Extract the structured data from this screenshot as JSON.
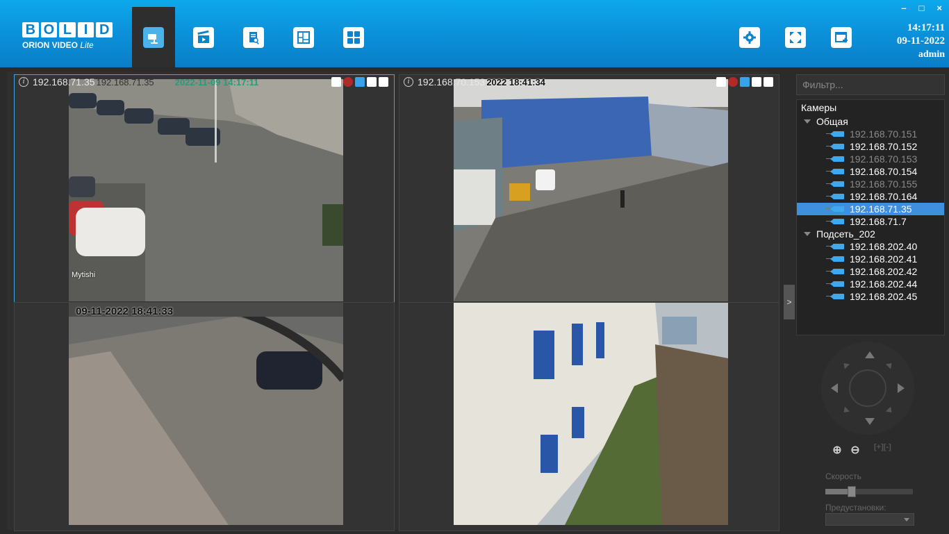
{
  "app": {
    "logo_letters": [
      "B",
      "O",
      "L",
      "I",
      "D"
    ],
    "logo_sub": "ORION VIDEO",
    "logo_sub_italic": "Lite"
  },
  "toolbar": {
    "tabs": [
      {
        "icon": "camera-icon",
        "active": true
      },
      {
        "icon": "clapperboard-icon",
        "active": false
      },
      {
        "icon": "document-search-icon",
        "active": false
      },
      {
        "icon": "map-layout-icon",
        "active": false
      },
      {
        "icon": "grid-layout-icon",
        "active": false
      }
    ],
    "right_icons": [
      "gear-icon",
      "fullscreen-icon",
      "add-window-icon"
    ],
    "win_controls": [
      "–",
      "□",
      "×"
    ]
  },
  "clock": {
    "time": "14:17:11",
    "date": "09-11-2022",
    "user": "admin"
  },
  "cells": [
    {
      "ip": "192.168.71.35",
      "overlay": "192.168.71.35",
      "ts": "2022-11-09 14:17:11",
      "label": "Mytishi",
      "selected": true
    },
    {
      "ip": "192.168.70.153",
      "overlay": "",
      "ts": "2022 18:41:34",
      "label": "",
      "selected": false
    },
    {
      "ip": "",
      "overlay": "",
      "ts": "09-11-2022 18:41:33",
      "label": "",
      "selected": false
    },
    {
      "ip": "",
      "overlay": "",
      "ts": "",
      "label": "",
      "selected": false
    }
  ],
  "panel": {
    "filter_placeholder": "Фильтр...",
    "tree_header": "Камеры",
    "groups": [
      {
        "name": "Общая",
        "cams": [
          {
            "ip": "192.168.70.151",
            "state": "dim"
          },
          {
            "ip": "192.168.70.152",
            "state": "on"
          },
          {
            "ip": "192.168.70.153",
            "state": "dim"
          },
          {
            "ip": "192.168.70.154",
            "state": "on"
          },
          {
            "ip": "192.168.70.155",
            "state": "dim"
          },
          {
            "ip": "192.168.70.164",
            "state": "on"
          },
          {
            "ip": "192.168.71.35",
            "state": "sel"
          },
          {
            "ip": "192.168.71.7",
            "state": "on"
          }
        ]
      },
      {
        "name": "Подсеть_202",
        "cams": [
          {
            "ip": "192.168.202.40",
            "state": "on"
          },
          {
            "ip": "192.168.202.41",
            "state": "on"
          },
          {
            "ip": "192.168.202.42",
            "state": "on"
          },
          {
            "ip": "192.168.202.44",
            "state": "on"
          },
          {
            "ip": "192.168.202.45",
            "state": "on"
          }
        ]
      }
    ],
    "expander": ">",
    "zoom_in": "⊕",
    "zoom_out": "⊖",
    "focus": "[+][-]",
    "speed_label": "Скорость",
    "speed_value": 0.3,
    "presets_label": "Предустановки:"
  }
}
